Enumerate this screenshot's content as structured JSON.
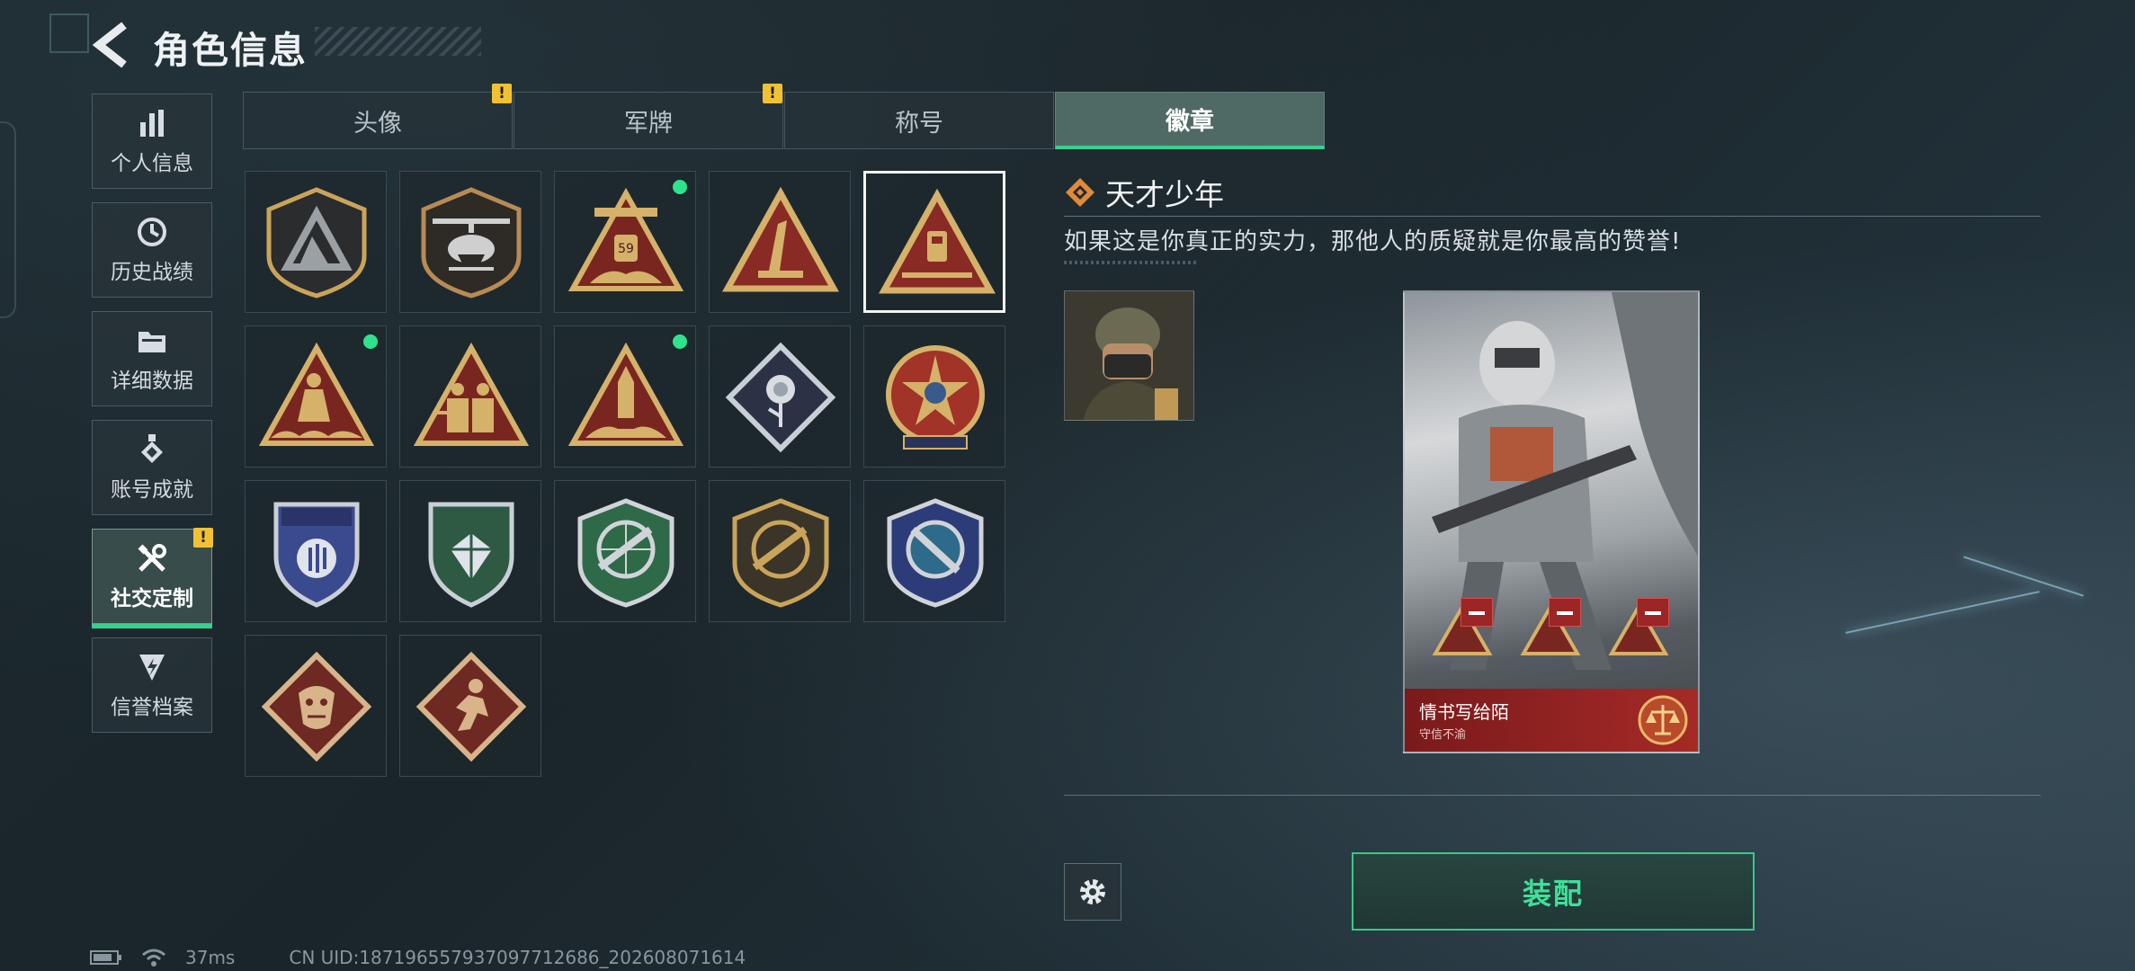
{
  "header": {
    "title": "角色信息",
    "back_icon": "back-arrow-icon"
  },
  "sidebar": {
    "items": [
      {
        "label": "个人信息",
        "icon": "bar-chart-icon",
        "active": false,
        "warning": false
      },
      {
        "label": "历史战绩",
        "icon": "history-clock-icon",
        "active": false,
        "warning": false
      },
      {
        "label": "详细数据",
        "icon": "folder-icon",
        "active": false,
        "warning": false
      },
      {
        "label": "账号成就",
        "icon": "medal-icon",
        "active": false,
        "warning": false
      },
      {
        "label": "社交定制",
        "icon": "tools-icon",
        "active": true,
        "warning": true
      },
      {
        "label": "信誉档案",
        "icon": "shield-bolt-icon",
        "active": false,
        "warning": false
      }
    ],
    "warning_mark": "!"
  },
  "tabs": [
    {
      "label": "头像",
      "warning": true,
      "active": false
    },
    {
      "label": "军牌",
      "warning": true,
      "active": false
    },
    {
      "label": "称号",
      "warning": false,
      "active": false
    },
    {
      "label": "徽章",
      "warning": false,
      "active": true
    }
  ],
  "badges": [
    {
      "name": "delta-shield-badge",
      "new": false,
      "selected": false
    },
    {
      "name": "helicopter-shield-badge",
      "new": false,
      "selected": false
    },
    {
      "name": "soldier-59-triangle-badge",
      "new": true,
      "selected": false
    },
    {
      "name": "number-one-triangle-badge",
      "new": false,
      "selected": false
    },
    {
      "name": "genius-youth-triangle-badge",
      "new": false,
      "selected": true
    },
    {
      "name": "figure-wave-triangle-badge",
      "new": true,
      "selected": false
    },
    {
      "name": "soldiers-group-triangle-badge",
      "new": false,
      "selected": false
    },
    {
      "name": "rocket-triangle-badge",
      "new": true,
      "selected": false
    },
    {
      "name": "rose-diamond-badge",
      "new": false,
      "selected": false
    },
    {
      "name": "star-wreath-badge",
      "new": false,
      "selected": false
    },
    {
      "name": "blue-laurel-shield-badge",
      "new": false,
      "selected": false
    },
    {
      "name": "green-gem-shield-badge",
      "new": false,
      "selected": false
    },
    {
      "name": "green-rifle-shield-badge",
      "new": false,
      "selected": false
    },
    {
      "name": "gold-rifle-shield-badge",
      "new": false,
      "selected": false
    },
    {
      "name": "blue-knife-shield-badge",
      "new": false,
      "selected": false
    },
    {
      "name": "dragon-diamond-badge",
      "new": false,
      "selected": false
    },
    {
      "name": "runner-diamond-badge",
      "new": false,
      "selected": false
    }
  ],
  "detail": {
    "badge_name": "天才少年",
    "badge_description": "如果这是你真正的实力，那他人的质疑就是你最高的赞誉!",
    "card": {
      "name": "情书写给陌",
      "subtitle": "守信不渝"
    },
    "equip_label": "装配"
  },
  "status": {
    "ping": "37ms",
    "uid": "CN UID:18719655793709771​2686_202608071614"
  },
  "colors": {
    "accent": "#37d08f",
    "warning": "#f0c233",
    "badge_gold": "#c9a45a",
    "badge_red": "#8a2a24"
  }
}
